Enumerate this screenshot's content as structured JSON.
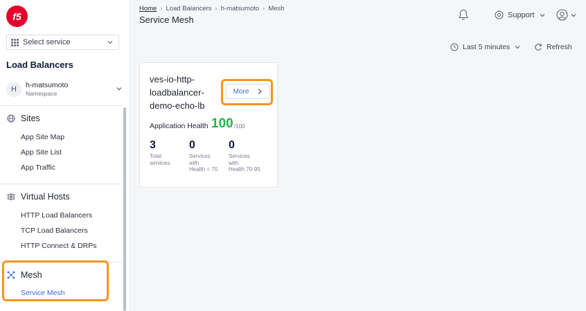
{
  "brand": {
    "logo_text": "f5",
    "accent": "#e4002b"
  },
  "service_select": {
    "placeholder": "Select service"
  },
  "sidebar": {
    "title": "Load Balancers",
    "namespace": {
      "avatar": "H",
      "name": "h-matsumoto",
      "label": "Namespace"
    },
    "sections": [
      {
        "title": "Sites",
        "icon": "globe-icon",
        "items": [
          "App Site Map",
          "App Site List",
          "App Traffic"
        ]
      },
      {
        "title": "Virtual Hosts",
        "icon": "server-icon",
        "items": [
          "HTTP Load Balancers",
          "TCP Load Balancers",
          "HTTP Connect & DRPs"
        ]
      },
      {
        "title": "Mesh",
        "icon": "mesh-icon",
        "items": [
          "Service Mesh"
        ],
        "active_item": "Service Mesh"
      }
    ]
  },
  "header": {
    "breadcrumb": [
      "Home",
      "Load Balancers",
      "h-matsumoto",
      "Mesh"
    ],
    "title": "Service Mesh",
    "support_label": "Support"
  },
  "toolbar": {
    "time_range": "Last 5 minutes",
    "refresh_label": "Refresh"
  },
  "card": {
    "name": "ves-io-http-loadbalancer-demo-echo-lb",
    "name_lines": [
      "ves-io-http-",
      "loadbalancer-",
      "demo-echo-lb"
    ],
    "more_label": "More",
    "health_label": "Application Health",
    "health_value": "100",
    "health_max": "/100",
    "stats": [
      {
        "value": "3",
        "label_lines": [
          "Total",
          "services"
        ]
      },
      {
        "value": "0",
        "label_lines": [
          "Services",
          "with",
          "Health < 70"
        ]
      },
      {
        "value": "0",
        "label_lines": [
          "Services",
          "with",
          "Health 70-95"
        ]
      }
    ]
  },
  "colors": {
    "highlight": "#f7941d",
    "health_good": "#27b34a",
    "link": "#3b6bd6"
  }
}
